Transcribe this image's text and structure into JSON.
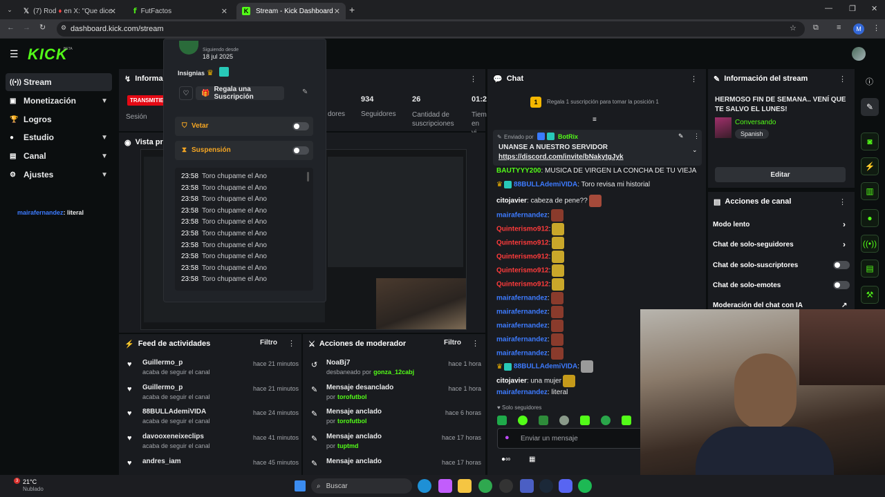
{
  "browser": {
    "tabs": [
      {
        "label": "(7) Rod",
        "label2": "en X: \"Que dices @t"
      },
      {
        "label": "FutFactos"
      },
      {
        "label": "Stream - Kick Dashboard"
      }
    ],
    "url": "dashboard.kick.com/stream",
    "profile_initial": "M"
  },
  "kick": {
    "logo": "KICK",
    "logo_badge": "BETA",
    "nav": [
      {
        "label": "Stream"
      },
      {
        "label": "Monetización"
      },
      {
        "label": "Logros"
      },
      {
        "label": "Estudio"
      },
      {
        "label": "Canal"
      },
      {
        "label": "Ajustes"
      }
    ],
    "sidebar_chat": {
      "user": "mairafernandez",
      "text": ": literal"
    }
  },
  "info_panel": {
    "title": "Informació",
    "badge": "TRANSMITIE",
    "sesion": "Sesión",
    "seguidores_label": "dores",
    "stats": [
      {
        "value": "934",
        "label": "Seguidores"
      },
      {
        "value": "26",
        "label": "Cantidad de suscripciones"
      },
      {
        "value": "01:2",
        "label": "Tiem en vi"
      }
    ]
  },
  "preview": {
    "title": "Vista previ"
  },
  "popup": {
    "following_label": "Siguiendo desde",
    "following_date": "18 jul 2025",
    "insignias": "Insignias",
    "gift_button": "Regala una Suscripción",
    "vetar": "Vetar",
    "suspension": "Suspensión",
    "messages": [
      {
        "time": "23:58",
        "text": "Toro chupame el Ano"
      },
      {
        "time": "23:58",
        "text": "Toro chupame el Ano"
      },
      {
        "time": "23:58",
        "text": "Toro chupame el Ano"
      },
      {
        "time": "23:58",
        "text": "Toro chupame el Ano"
      },
      {
        "time": "23:58",
        "text": "Toro chupame el Ano"
      },
      {
        "time": "23:58",
        "text": "Toro chupame el Ano"
      },
      {
        "time": "23:58",
        "text": "Toro chupame el Ano"
      },
      {
        "time": "23:58",
        "text": "Toro chupame el Ano"
      },
      {
        "time": "23:58",
        "text": "Toro chupame el Ano"
      },
      {
        "time": "23:58",
        "text": "Toro chupame el Ano"
      }
    ]
  },
  "activity": {
    "title": "Feed de actividades",
    "filter": "Filtro",
    "items": [
      {
        "user": "Guillermo_p",
        "action": "acaba de seguir el canal",
        "time": "hace 21 minutos"
      },
      {
        "user": "Guillermo_p",
        "action": "acaba de seguir el canal",
        "time": "hace 21 minutos"
      },
      {
        "user": "88BULLAdemiVIDA",
        "action": "acaba de seguir el canal",
        "time": "hace 24 minutos"
      },
      {
        "user": "davooxeneixeclips",
        "action": "acaba de seguir el canal",
        "time": "hace 41 minutos"
      },
      {
        "user": "andres_iam",
        "action": "",
        "time": "hace 45 minutos"
      }
    ]
  },
  "moderator": {
    "title": "Acciones de moderador",
    "filter": "Filtro",
    "items": [
      {
        "title": "NoaBj7",
        "sub": "desbaneado por",
        "by": "gonza_12cabj",
        "time": "hace 1 hora"
      },
      {
        "title": "Mensaje desanclado",
        "sub": "por",
        "by": "torofutbol",
        "time": "hace 1 hora"
      },
      {
        "title": "Mensaje anclado",
        "sub": "por",
        "by": "torofutbol",
        "time": "hace 6 horas"
      },
      {
        "title": "Mensaje anclado",
        "sub": "por",
        "by": "tuptmd",
        "time": "hace 17 horas"
      },
      {
        "title": "Mensaje anclado",
        "sub": "",
        "by": "",
        "time": "hace 17 horas"
      }
    ]
  },
  "chat": {
    "title": "Chat",
    "gift_rank": "1",
    "gift_text": "Regala 1 suscripción para tomar la posición 1",
    "pinned_by": "Enviado por",
    "pinned_user": "BotRix",
    "pinned_text": "UNANSE A NUESTRO SERVIDOR",
    "pinned_link": "https://discord.com/invite/bNakytgJyk",
    "messages": [
      {
        "user": "BAUTYYY200",
        "color": "#53fc18",
        "text": ": MUSICA DE VIRGEN LA CONCHA DE TU VIEJA"
      },
      {
        "user": "88BULLAdemiVIDA",
        "color": "#3d7bff",
        "text": ": Toro revisa mi historial"
      },
      {
        "user": "citojavier",
        "color": "#ffffff",
        "text": ": cabeza de pene??"
      },
      {
        "user": "mairafernandez",
        "color": "#3d7bff",
        "text": ":"
      },
      {
        "user": "Quinterismo912",
        "color": "#ff3b3b",
        "text": ":"
      },
      {
        "user": "Quinterismo912",
        "color": "#ff3b3b",
        "text": ":"
      },
      {
        "user": "Quinterismo912",
        "color": "#ff3b3b",
        "text": ":"
      },
      {
        "user": "Quinterismo912",
        "color": "#ff3b3b",
        "text": ":"
      },
      {
        "user": "Quinterismo912",
        "color": "#ff3b3b",
        "text": ":"
      },
      {
        "user": "mairafernandez",
        "color": "#3d7bff",
        "text": ":"
      },
      {
        "user": "mairafernandez",
        "color": "#3d7bff",
        "text": ":"
      },
      {
        "user": "mairafernandez",
        "color": "#3d7bff",
        "text": ":"
      },
      {
        "user": "mairafernandez",
        "color": "#3d7bff",
        "text": ":"
      },
      {
        "user": "mairafernandez",
        "color": "#3d7bff",
        "text": ":"
      },
      {
        "user": "88BULLAdemiVIDA",
        "color": "#3d7bff",
        "text": ":"
      },
      {
        "user": "citojavier",
        "color": "#ffffff",
        "text": ": una mujer"
      },
      {
        "user": "mairafernandez",
        "color": "#3d7bff",
        "text": ": literal"
      }
    ],
    "followers_only": "Solo seguidores",
    "input_placeholder": "Enviar un mensaje"
  },
  "stream_info": {
    "title": "Información del stream",
    "stream_title": "HERMOSO FIN DE SEMANA.. VENÍ QUE TE SALVO EL LUNES!",
    "category": "Conversando",
    "language": "Spanish",
    "edit": "Editar"
  },
  "channel_actions": {
    "title": "Acciones de canal",
    "items": [
      {
        "label": "Modo lento"
      },
      {
        "label": "Chat de solo-seguidores"
      },
      {
        "label": "Chat de solo-suscriptores"
      },
      {
        "label": "Chat de solo-emotes"
      },
      {
        "label": "Moderación del chat con IA"
      }
    ]
  },
  "taskbar": {
    "temp": "21°C",
    "weather": "Nublado",
    "search": "Buscar",
    "notif": "3"
  }
}
